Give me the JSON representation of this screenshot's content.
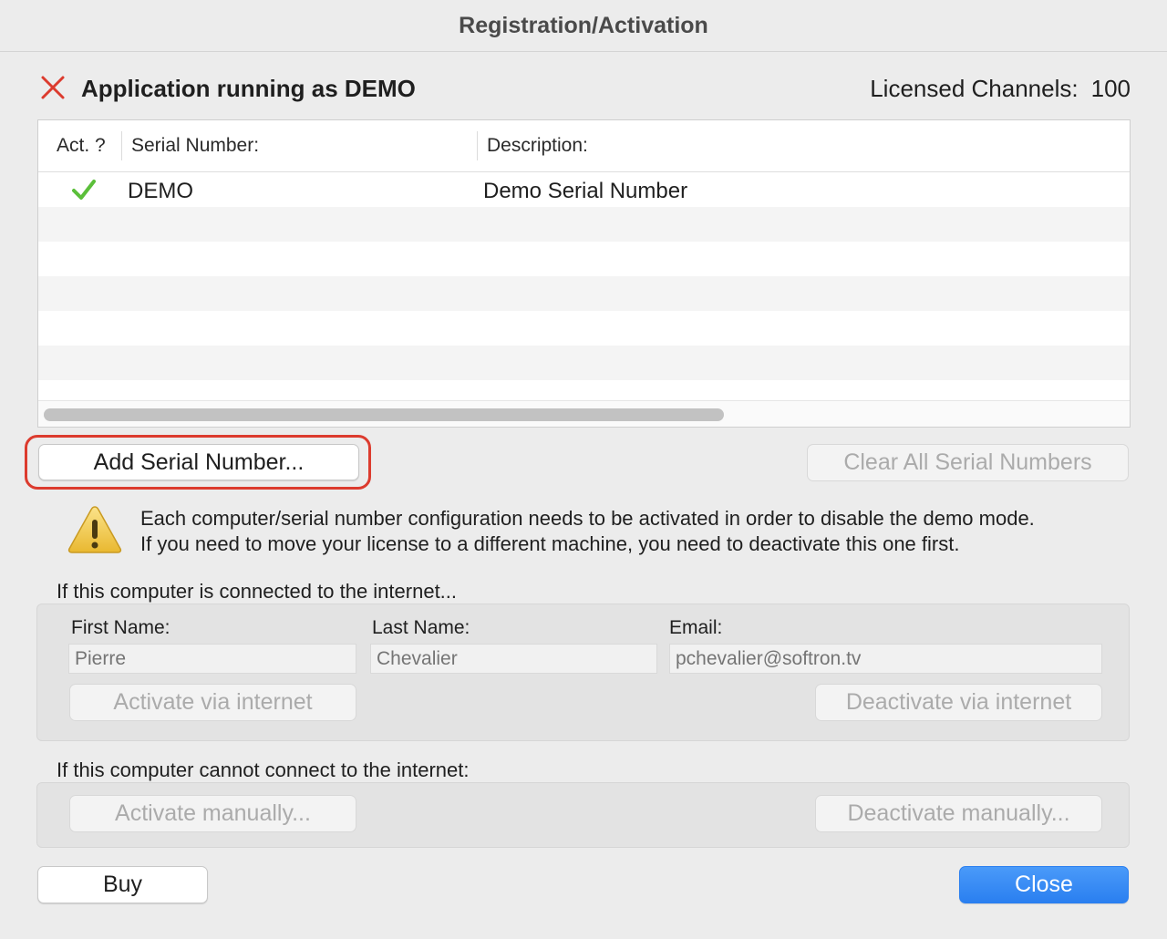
{
  "window": {
    "title": "Registration/Activation"
  },
  "status": {
    "icon": "close-x-icon",
    "text": "Application running as DEMO",
    "licensed_label": "Licensed Channels:",
    "licensed_value": "100",
    "color": "#dc3b2e"
  },
  "table": {
    "headers": {
      "active": "Act. ?",
      "serial": "Serial Number:",
      "description": "Description:"
    },
    "rows": [
      {
        "active_icon": "checkmark-icon",
        "serial": "DEMO",
        "description": "Demo Serial Number"
      }
    ]
  },
  "buttons": {
    "add_serial": "Add Serial Number...",
    "clear_all": "Clear All Serial Numbers",
    "activate_internet": "Activate via internet",
    "deactivate_internet": "Deactivate via internet",
    "activate_manual": "Activate manually...",
    "deactivate_manual": "Deactivate manually...",
    "buy": "Buy",
    "close": "Close"
  },
  "warning": {
    "icon": "warning-triangle-icon",
    "line1": "Each computer/serial number configuration needs to be activated in order to disable the demo mode.",
    "line2": "If you need to move your license to a different machine, you need to deactivate this one first."
  },
  "internet_section": {
    "label": "If this computer is connected to the internet...",
    "first_name_label": "First Name:",
    "last_name_label": "Last Name:",
    "email_label": "Email:",
    "first_name_placeholder": "Pierre",
    "last_name_placeholder": "Chevalier",
    "email_placeholder": "pchevalier@softron.tv"
  },
  "manual_section": {
    "label": "If this computer cannot connect to the internet:"
  },
  "colors": {
    "accent": "#2f86f5",
    "check": "#5bbf3a",
    "highlight": "#dc3b2e"
  }
}
